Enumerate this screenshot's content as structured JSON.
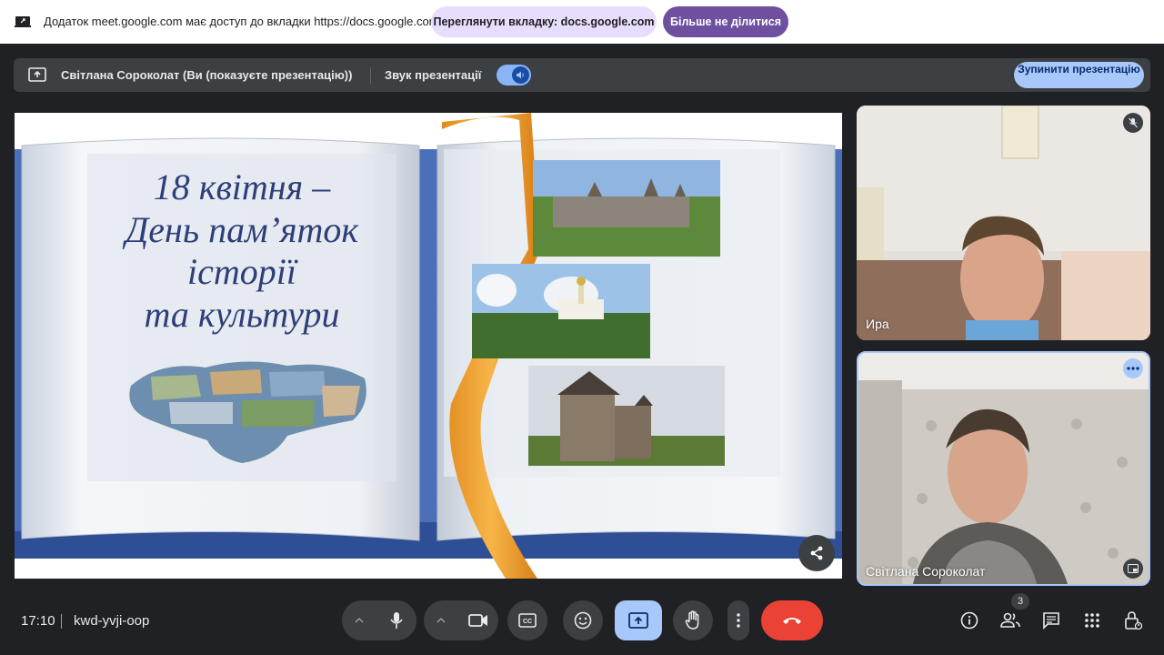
{
  "infobar": {
    "message": "Додаток meet.google.com має доступ до вкладки https://docs.google.com",
    "view_tab_button": "Переглянути вкладку: docs.google.com",
    "stop_sharing_button": "Більше не ділитися"
  },
  "presenting_bar": {
    "presenter": "Світлана Сороколат (Ви (показуєте презентацію))",
    "audio_label": "Звук презентації",
    "audio_on": true,
    "stop_presenting_button": "Зупинити презентацію"
  },
  "slide": {
    "title_lines": [
      "18 квітня –",
      "День пам’яток",
      "історії",
      "та культури"
    ]
  },
  "participants": [
    {
      "name": "Ира",
      "muted": true
    },
    {
      "name": "Світлана Сороколат",
      "muted": false
    }
  ],
  "meeting": {
    "time": "17:10",
    "code": "kwd-yvji-oop",
    "people_count": "3"
  },
  "colors": {
    "hangup": "#ea4335",
    "present_active": "#a8c7fa",
    "control_bg": "#3c4043",
    "ribbon": "#f0a030"
  }
}
